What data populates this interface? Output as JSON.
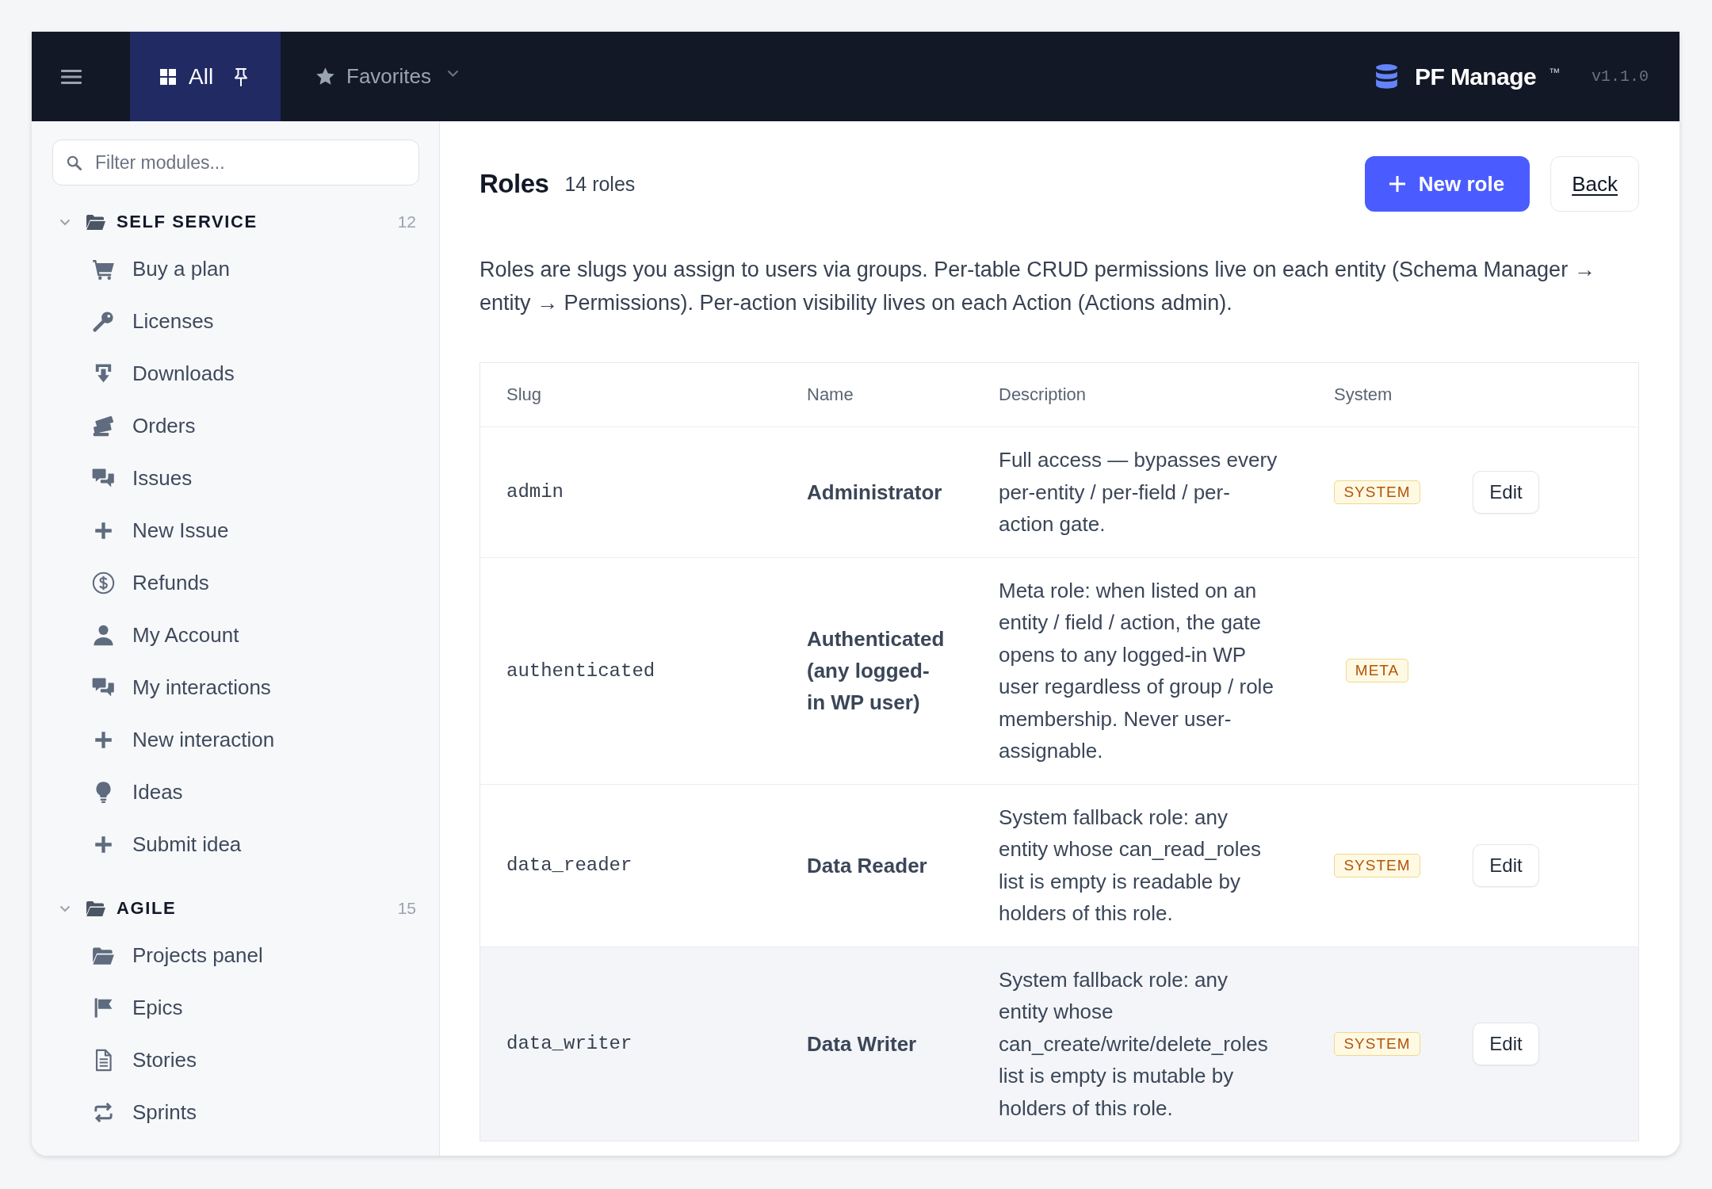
{
  "topbar": {
    "tabs": [
      {
        "label": "All",
        "kind": "pinned",
        "selected": true
      },
      {
        "label": "Favorites",
        "kind": "menu",
        "selected": false
      }
    ],
    "brand": {
      "name": "PF Manage",
      "trademark": "™",
      "version": "v1.1.0"
    }
  },
  "sidebar": {
    "filter": {
      "placeholder": "Filter modules..."
    },
    "groups": [
      {
        "label": "SELF SERVICE",
        "count": "12",
        "expanded": true,
        "items": [
          {
            "label": "Buy a plan"
          },
          {
            "label": "Licenses"
          },
          {
            "label": "Downloads"
          },
          {
            "label": "Orders"
          },
          {
            "label": "Issues"
          },
          {
            "label": "New Issue"
          },
          {
            "label": "Refunds"
          },
          {
            "label": "My Account"
          },
          {
            "label": "My interactions"
          },
          {
            "label": "New interaction"
          },
          {
            "label": "Ideas"
          },
          {
            "label": "Submit idea"
          }
        ]
      },
      {
        "label": "AGILE",
        "count": "15",
        "expanded": true,
        "items": [
          {
            "label": "Projects panel"
          },
          {
            "label": "Epics"
          },
          {
            "label": "Stories"
          },
          {
            "label": "Sprints"
          }
        ]
      }
    ]
  },
  "main": {
    "title": "Roles",
    "count": "14 roles",
    "buttons": [
      {
        "label": "New role",
        "kind": "primary"
      },
      {
        "label": "Back",
        "kind": "secondary"
      }
    ],
    "description": "Roles are slugs you assign to users via groups. Per-table CRUD permissions live on each entity (Schema Manager → entity → Permissions). Per-action visibility lives on each Action (Actions admin).",
    "table": {
      "columns": [
        "Slug",
        "Name",
        "Description",
        "System"
      ],
      "rows": [
        {
          "slug": "admin",
          "name": "Administrator",
          "description": "Full access — bypasses every per-entity / per-field / per-action gate.",
          "badge": "SYSTEM",
          "action": "Edit",
          "highlighted": false
        },
        {
          "slug": "authenticated",
          "name": "Authenticated (any logged-in WP user)",
          "description": "Meta role: when listed on an entity / field / action, the gate opens to any logged-in WP user regardless of group / role membership. Never user-assignable.",
          "badge": "META",
          "highlighted": false
        },
        {
          "slug": "data_reader",
          "name": "Data Reader",
          "description": "System fallback role: any entity whose can_read_roles list is empty is readable by holders of this role.",
          "badge": "SYSTEM",
          "action": "Edit",
          "highlighted": false
        },
        {
          "slug": "data_writer",
          "name": "Data Writer",
          "description": "System fallback role: any entity whose can_create/write/delete_roles list is empty is mutable by holders of this role.",
          "badge": "SYSTEM",
          "action": "Edit",
          "highlighted": true
        }
      ]
    }
  }
}
